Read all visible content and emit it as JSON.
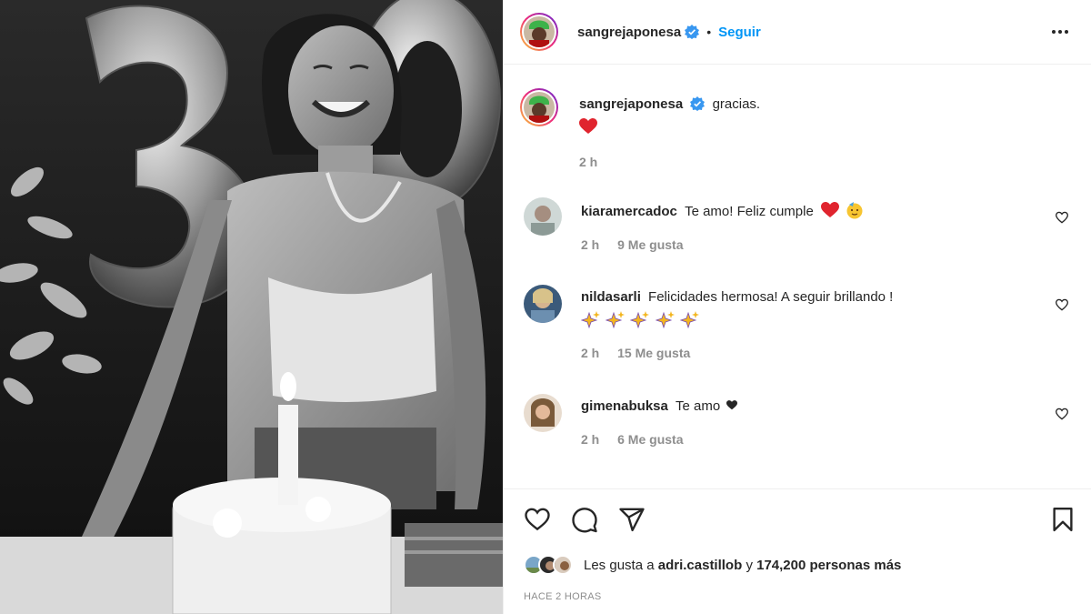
{
  "post": {
    "username": "sangrejaponesa",
    "follow_label": "Seguir",
    "separator": "•",
    "photo_alt": "birthday photo with balloons and cake"
  },
  "caption": {
    "username": "sangrejaponesa",
    "text": "gracias.",
    "emoji": "heart",
    "time": "2 h"
  },
  "comments": [
    {
      "username": "kiaramercadoc",
      "text": "Te amo! Feliz cumple",
      "emojis": [
        "heart",
        "partying-face"
      ],
      "time": "2 h",
      "likes": "9 Me gusta"
    },
    {
      "username": "nildasarli",
      "text": "Felicidades hermosa! A seguir brillando !",
      "emojis": [
        "sparkles",
        "sparkles",
        "sparkles",
        "sparkles",
        "sparkles"
      ],
      "time": "2 h",
      "likes": "15 Me gusta"
    },
    {
      "username": "gimenabuksa",
      "text": "Te amo",
      "emojis": [
        "black-heart"
      ],
      "time": "2 h",
      "likes": "6 Me gusta"
    }
  ],
  "likes": {
    "prefix": "Les gusta a",
    "user": "adri.castillob",
    "middle": "y",
    "count": "174,200 personas más"
  },
  "posted_ago": "HACE 2 HORAS",
  "icons": {
    "more": "more-options-icon",
    "like": "heart-outline-icon",
    "comment": "comment-bubble-icon",
    "share": "paper-plane-icon",
    "save": "bookmark-icon",
    "verified": "verified-badge-icon"
  },
  "colors": {
    "link": "#0095f6",
    "verified": "#3897f0",
    "muted": "#8e8e8e",
    "heart_emoji": "#e0242e"
  }
}
